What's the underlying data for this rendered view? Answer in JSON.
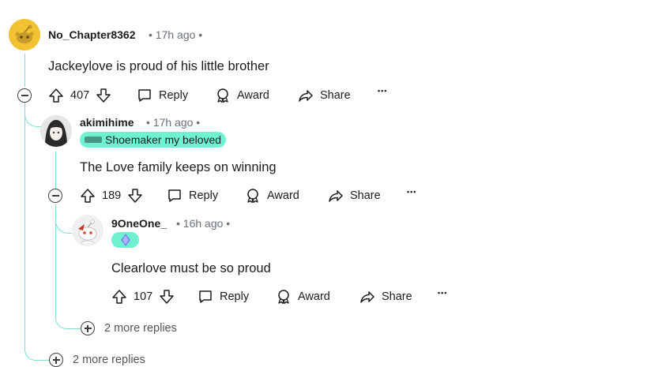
{
  "comments": [
    {
      "username": "No_Chapter8362",
      "time": "• 17h ago •",
      "text": "Jackeylove is proud of his little brother",
      "votes": "407"
    },
    {
      "username": "akimihime",
      "time": "• 17h ago •",
      "flair": "Shoemaker my beloved",
      "text": "The Love family keeps on winning",
      "votes": "189"
    },
    {
      "username": "9OneOne_",
      "time": "• 16h ago •",
      "text": "Clearlove must be so proud",
      "votes": "107"
    }
  ],
  "actions": {
    "reply": "Reply",
    "award": "Award",
    "share": "Share",
    "more": "•••"
  },
  "more_replies": [
    "2 more replies",
    "2 more replies"
  ],
  "colors": {
    "thread_line": "#7ee0d1",
    "flair_bg": "#6ef2d2",
    "avatar_gold": "#f2c233",
    "meta_text": "#6a7178"
  },
  "icons": [
    "snoo-avatar-icon",
    "upvote-icon",
    "downvote-icon",
    "reply-icon",
    "award-icon",
    "share-icon",
    "collapse-icon",
    "expand-icon",
    "diamond-flair-icon"
  ]
}
